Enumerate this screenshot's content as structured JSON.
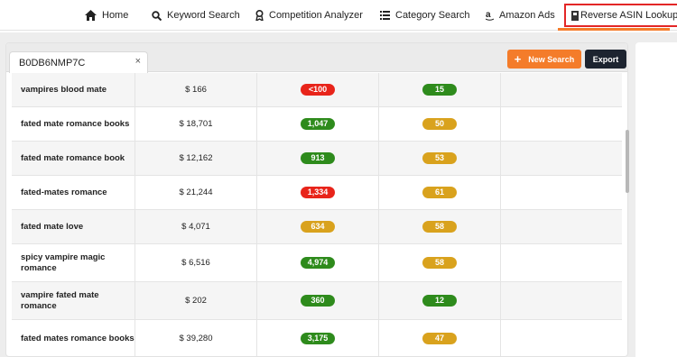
{
  "nav": {
    "items": [
      {
        "label": "Home",
        "icon": "home-icon"
      },
      {
        "label": "Keyword Search",
        "icon": "search-icon"
      },
      {
        "label": "Competition Analyzer",
        "icon": "award-icon"
      },
      {
        "label": "Category Search",
        "icon": "list-icon"
      },
      {
        "label": "Amazon Ads",
        "icon": "amazon-icon"
      },
      {
        "label": "Reverse ASIN Lookup",
        "icon": "book-icon",
        "active": true
      }
    ]
  },
  "tab": {
    "label": "B0DB6NMP7C",
    "close": "×"
  },
  "actions": {
    "new_search": "New Search",
    "new_search_icon": "+",
    "export": "Export"
  },
  "colors": {
    "accent": "#f47c2a",
    "dark": "#1d2430",
    "red": "#e8241a",
    "green": "#2e8b1c",
    "gold": "#d9a21d",
    "active_border": "#e32626"
  },
  "rows": [
    {
      "keyword": "vampires blood mate",
      "price": "$ 166",
      "rank": "<100",
      "rank_color": "red",
      "score": "15",
      "score_color": "green"
    },
    {
      "keyword": "fated mate romance books",
      "price": "$ 18,701",
      "rank": "1,047",
      "rank_color": "green",
      "score": "50",
      "score_color": "gold"
    },
    {
      "keyword": "fated mate romance book",
      "price": "$ 12,162",
      "rank": "913",
      "rank_color": "green",
      "score": "53",
      "score_color": "gold"
    },
    {
      "keyword": "fated-mates romance",
      "price": "$ 21,244",
      "rank": "1,334",
      "rank_color": "red",
      "score": "61",
      "score_color": "gold"
    },
    {
      "keyword": "fated mate love",
      "price": "$ 4,071",
      "rank": "634",
      "rank_color": "gold",
      "score": "58",
      "score_color": "gold"
    },
    {
      "keyword": "spicy vampire magic romance",
      "price": "$ 6,516",
      "rank": "4,974",
      "rank_color": "green",
      "score": "58",
      "score_color": "gold"
    },
    {
      "keyword": "vampire fated mate romance",
      "price": "$ 202",
      "rank": "360",
      "rank_color": "green",
      "score": "12",
      "score_color": "green"
    },
    {
      "keyword": "fated mates romance books",
      "price": "$ 39,280",
      "rank": "3,175",
      "rank_color": "green",
      "score": "47",
      "score_color": "gold"
    }
  ]
}
